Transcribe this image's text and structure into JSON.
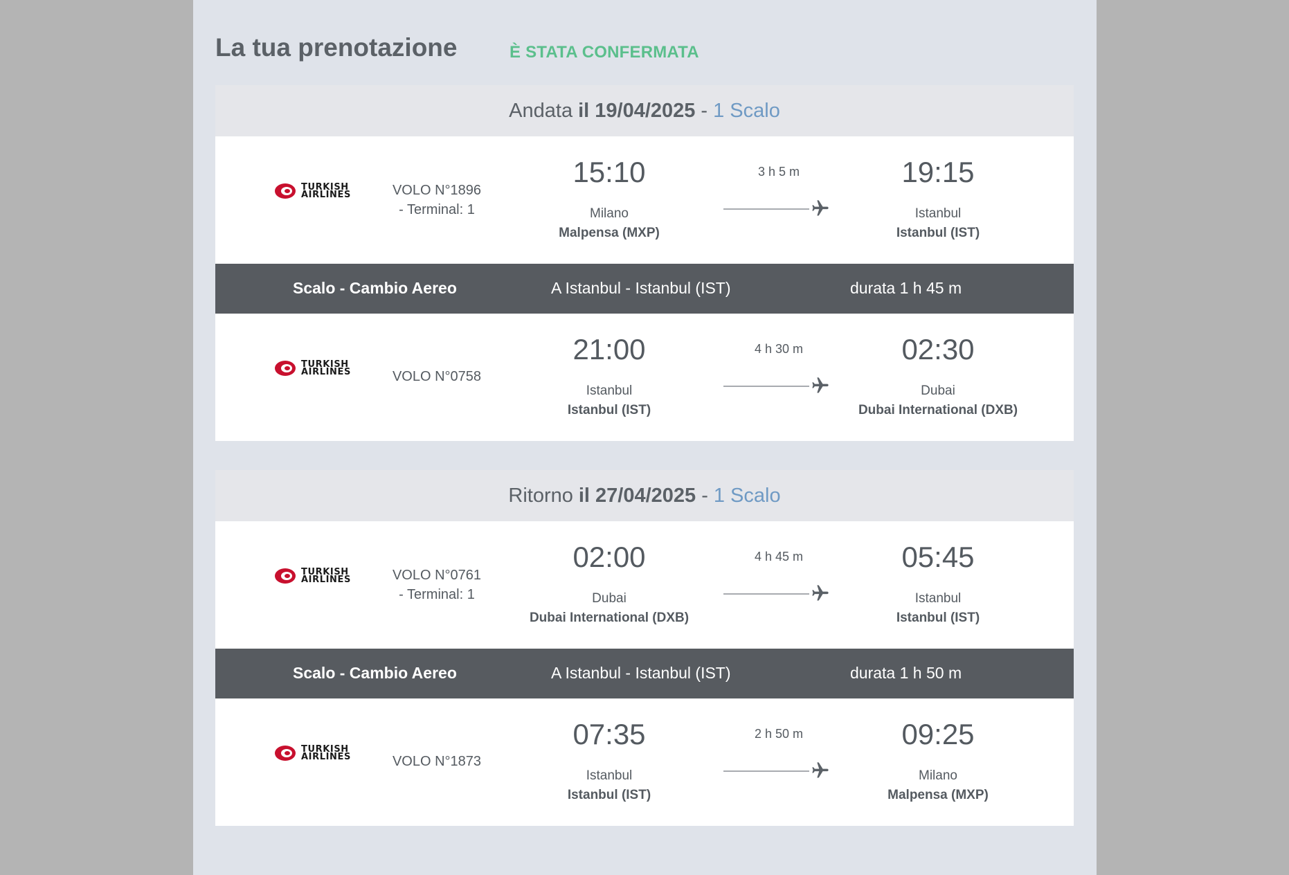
{
  "header": {
    "title": "La tua prenotazione",
    "status": "È STATA CONFERMATA"
  },
  "outbound": {
    "label": "Andata",
    "date": "il 19/04/2025",
    "separator": "-",
    "stops": "1 Scalo",
    "flights": [
      {
        "airline_line1": "TURKISH",
        "airline_line2": "AIRLINES",
        "flight_no": "VOLO N°1896",
        "terminal": "- Terminal: 1",
        "dep_time": "15:10",
        "dep_city": "Milano",
        "dep_airport": "Malpensa (MXP)",
        "duration": "3 h 5 m",
        "arr_time": "19:15",
        "arr_city": "Istanbul",
        "arr_airport": "Istanbul (IST)"
      },
      {
        "airline_line1": "TURKISH",
        "airline_line2": "AIRLINES",
        "flight_no": "VOLO N°0758",
        "dep_time": "21:00",
        "dep_city": "Istanbul",
        "dep_airport": "Istanbul (IST)",
        "duration": "4 h 30 m",
        "arr_time": "02:30",
        "arr_city": "Dubai",
        "arr_airport": "Dubai International (DXB)"
      }
    ],
    "layover": {
      "type": "Scalo - Cambio Aereo",
      "place": "A Istanbul - Istanbul (IST)",
      "duration": "durata 1 h 45 m"
    }
  },
  "return": {
    "label": "Ritorno",
    "date": "il 27/04/2025",
    "separator": "-",
    "stops": "1 Scalo",
    "flights": [
      {
        "airline_line1": "TURKISH",
        "airline_line2": "AIRLINES",
        "flight_no": "VOLO N°0761",
        "terminal": "- Terminal: 1",
        "dep_time": "02:00",
        "dep_city": "Dubai",
        "dep_airport": "Dubai International (DXB)",
        "duration": "4 h 45 m",
        "arr_time": "05:45",
        "arr_city": "Istanbul",
        "arr_airport": "Istanbul (IST)"
      },
      {
        "airline_line1": "TURKISH",
        "airline_line2": "AIRLINES",
        "flight_no": "VOLO N°1873",
        "dep_time": "07:35",
        "dep_city": "Istanbul",
        "dep_airport": "Istanbul (IST)",
        "duration": "2 h 50 m",
        "arr_time": "09:25",
        "arr_city": "Milano",
        "arr_airport": "Malpensa (MXP)"
      }
    ],
    "layover": {
      "type": "Scalo - Cambio Aereo",
      "place": "A Istanbul - Istanbul (IST)",
      "duration": "durata 1 h 50 m"
    }
  }
}
